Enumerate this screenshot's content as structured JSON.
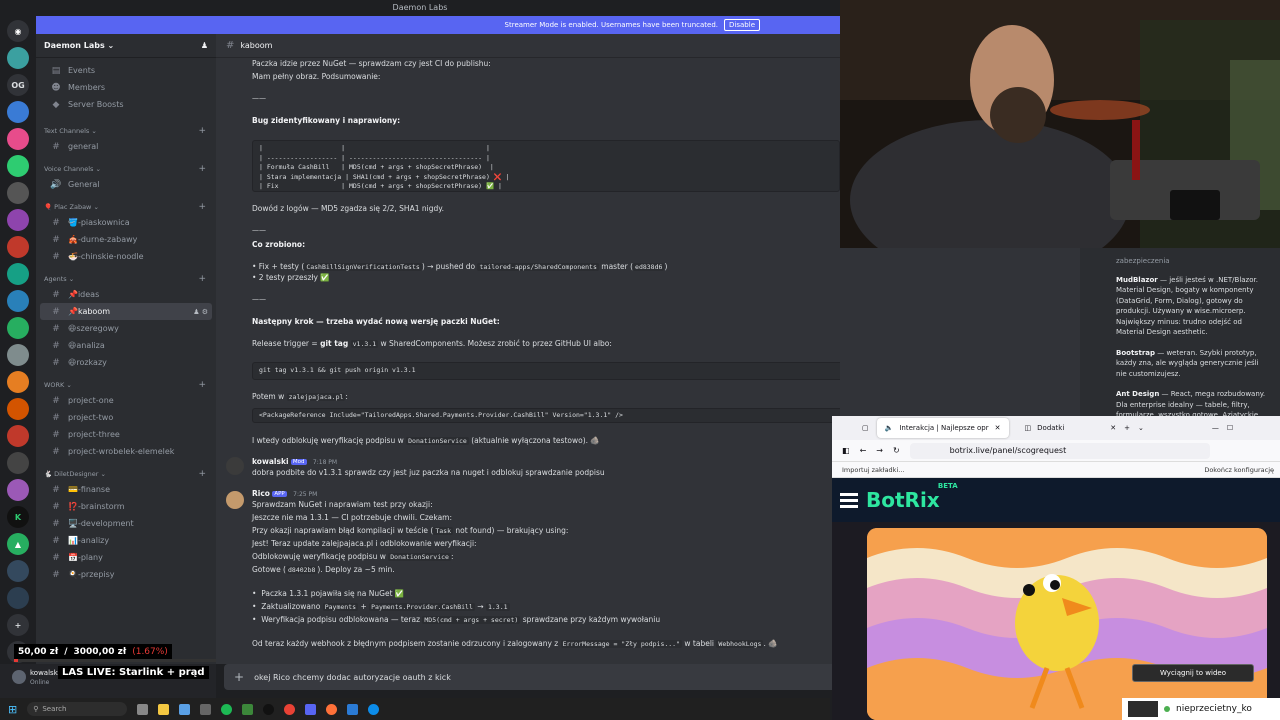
{
  "window": {
    "title": "Daemon Labs"
  },
  "banner": {
    "text": "Streamer Mode is enabled. Usernames have been truncated.",
    "button": "Disable"
  },
  "rail": {
    "items": [
      "OG"
    ]
  },
  "guild": {
    "name": "Daemon Labs"
  },
  "sidebar": {
    "top_items": [
      {
        "icon": "calendar-icon",
        "label": "Events"
      },
      {
        "icon": "members-icon",
        "label": "Members"
      },
      {
        "icon": "boost-icon",
        "label": "Server Boosts"
      }
    ],
    "categories": [
      {
        "name": "Text Channels",
        "channels": [
          "general"
        ]
      },
      {
        "name": "Voice Channels",
        "channels": [
          "General"
        ]
      },
      {
        "name": "🎈 Plac Zabaw",
        "channels": [
          "🪣-piaskownica",
          "🎪-durne-zabawy",
          "🍜-chinskie-noodle"
        ]
      },
      {
        "name": "Agents",
        "channels": [
          "📌ideas",
          "📌kaboom",
          "😆szeregowy",
          "😆analiza",
          "😆rozkazy"
        ]
      },
      {
        "name": "WORK",
        "channels": [
          "project-one",
          "project-two",
          "project-three",
          "project-wrobelek-elemelek"
        ]
      },
      {
        "name": "🐇 DiletDesigner",
        "channels": [
          "💳-finanse",
          "⁉️-brainstorm",
          "🖥️-development",
          "📊-analizy",
          "📅-plany",
          "🍳-przepisy"
        ]
      }
    ]
  },
  "channel": {
    "name": "kaboom"
  },
  "messages": {
    "l1": "Paczka idzie przez NuGet — sprawdzam czy jest CI do publishu:",
    "l2": "Mam pełny obraz. Podsumowanie:",
    "sep": "——",
    "bug_title": "Bug zidentyfikowany i naprawiony:",
    "table": "|                    |                                    |\n| ------------------ | ---------------------------------- |\n| Formuła CashBill   | MD5(cmd + args + shopSecretPhrase)  |\n| Stara implementacja | SHA1(cmd + args + shopSecretPhrase) ❌ |\n| Fix                | MD5(cmd + args + shopSecretPhrase) ✅ |",
    "proof": "Dowód z logów — MD5 zgadza się 2/2, SHA1 nigdy.",
    "done_title": "Co zrobiono:",
    "done1_a": "• Fix + testy (",
    "done1_code1": "CashBillSignVerificationTests",
    "done1_b": ") → pushed do",
    "done1_code2": "tailored-apps/SharedComponents",
    "done1_c": "master (",
    "done1_code3": "ed838d6",
    "done1_d": ")",
    "done2": "• 2 testy przeszły ✅",
    "next_title": "Następny krok — trzeba wydać nową wersję paczki NuGet:",
    "release_a": "Release trigger =",
    "release_b": "git tag",
    "release_code": "v1.3.1",
    "release_c": "w SharedComponents. Możesz zrobić to przez GitHub UI albo:",
    "git_cmd": "git tag v1.3.1 && git push origin v1.3.1",
    "potem_a": "Potem w",
    "potem_code": "zalejpajaca.pl",
    "potem_b": ":",
    "pkgref": "<PackageReference Include=\"TailoredApps.Shared.Payments.Provider.CashBill\" Version=\"1.3.1\" />",
    "unblock_a": "I wtedy odblokuję weryfikację podpisu w",
    "unblock_code": "DonationService",
    "unblock_b": "(aktualnie wyłączona testowo). 🪨",
    "msg2_author": "kowalski",
    "msg2_tag": "Mod",
    "msg2_time": "7:18 PM",
    "msg2_text": "dobra podbite do v1.3.1 sprawdz czy jest juz paczka na nuget i odblokuj sprawdzanie podpisu",
    "msg3_author": "Rico",
    "msg3_tag": "APP",
    "msg3_time": "7:25 PM",
    "r1": "Sprawdzam NuGet i naprawiam test przy okazji:",
    "r2": "Jeszcze nie ma 1.3.1 — CI potrzebuje chwili. Czekam:",
    "r3_a": "Przy okazji naprawiam błąd kompilacji w teście (",
    "r3_code": "Task",
    "r3_b": "not found) — brakujący using:",
    "r4": "Jest! Teraz update zalejpajaca.pl i odblokowanie weryfikacji:",
    "r5_a": "Odblokowuję weryfikację podpisu w",
    "r5_code": "DonationService",
    "r5_b": ":",
    "r6_a": "Gotowe (",
    "r6_code": "d8402b8",
    "r6_b": "). Deploy za ~5 min.",
    "bul1": "Paczka 1.3.1 pojawiła się na NuGet ✅",
    "bul2_a": "Zaktualizowano",
    "bul2_code1": "Payments",
    "bul2_plus": "+",
    "bul2_code2": "Payments.Provider.CashBill",
    "bul2_arrow": "→",
    "bul2_code3": "1.3.1",
    "bul3_a": "Weryfikacja podpisu odblokowana — teraz",
    "bul3_code": "MD5(cmd + args + secret)",
    "bul3_b": "sprawdzane przy każdym wywołaniu",
    "final_a": "Od teraz każdy webhook z błędnym podpisem zostanie odrzucony i zalogowany z",
    "final_code1": "ErrorMessage = \"Zły podpis...\"",
    "final_b": "w tabeli",
    "final_code2": "WebhookLogs",
    "final_c": ". 🪨"
  },
  "composer": {
    "text": "okej Rico chcemy dodac autoryzacje oauth z kick"
  },
  "user": {
    "name": "kowalski",
    "status": "Online"
  },
  "overlay": {
    "goal_current": "50,00 zł",
    "goal_sep": "/",
    "goal_target": "3000,00 zł",
    "goal_pct": "(1.67%)",
    "goal_fraction": 0.0167,
    "live_title": "LAS LIVE: Starlink + prąd",
    "viewer_name": "nieprzecietny_ko"
  },
  "taskbar": {
    "search": "Search"
  },
  "rightpanel": {
    "p0": "zabezpieczenia",
    "p1_b": "MudBlazor",
    "p1": " — jeśli jesteś w .NET/Blazor. Material Design, bogaty w komponenty (DataGrid, Form, Dialog), gotowy do produkcji. Używany w wise.microerp. Największy minus: trudno odejść od Material Design aesthetic.",
    "p2_b": "Bootstrap",
    "p2": " — weteran. Szybki prototyp, każdy zna, ale wygląda generycznie jeśli nie customizujesz.",
    "p3_b": "Ant Design",
    "p3": " — React, mega rozbudowany. Dla enterprise idealny — tabele, filtry, formularze, wszystko gotowe. Azjatyckie"
  },
  "browser": {
    "tab1": "Interakcja | Najlepsze opr",
    "tab2": "Dodatki",
    "url": "botrix.live/panel/scogrequest",
    "bookmark": "Importuj zakładki...",
    "bookmark_right": "Dokończ konfigurację",
    "logo": "BotRix",
    "beta": "BETA",
    "pip": "Wyciągnij to wideo"
  }
}
